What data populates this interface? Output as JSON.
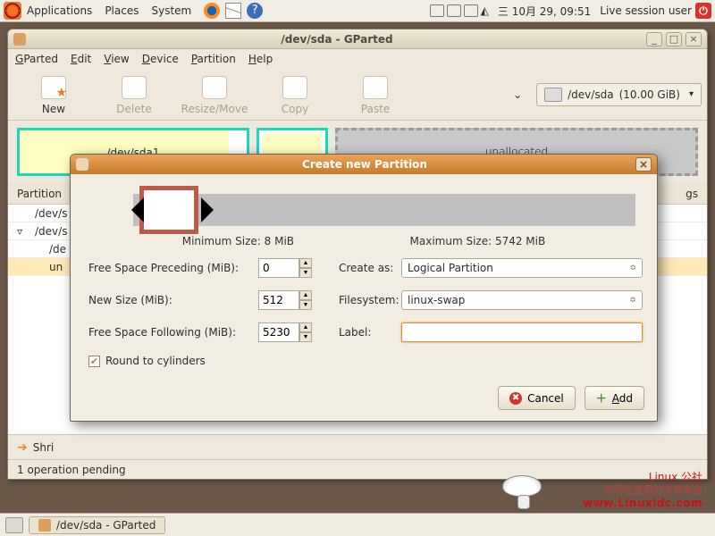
{
  "panel": {
    "menus": {
      "applications": "Applications",
      "places": "Places",
      "system": "System"
    },
    "clock": "三 10月 29, 09:51",
    "vol_icon": "◭",
    "user_label": "Live session user"
  },
  "window": {
    "title": "/dev/sda - GParted",
    "minimize": "_",
    "maximize": "□",
    "close": "×",
    "menubar": {
      "gparted": "GParted",
      "edit": "Edit",
      "view": "View",
      "device": "Device",
      "partition": "Partition",
      "help": "Help"
    },
    "toolbar": {
      "new": "New",
      "delete": "Delete",
      "resize": "Resize/Move",
      "copy": "Copy",
      "paste": "Paste"
    },
    "device": {
      "path": "/dev/sda",
      "size": "(10.00 GiB)"
    },
    "graph": {
      "p1": "/dev/sda1",
      "unalloc": "unallocated"
    },
    "table": {
      "header_partition": "Partition",
      "header_flags_suffix": "gs",
      "rows": [
        "/dev/s",
        "/dev/s",
        "/de",
        "un"
      ]
    },
    "ops": {
      "shrink": "Shri"
    },
    "statusbar": "1 operation pending"
  },
  "dialog": {
    "title": "Create new Partition",
    "close": "×",
    "min_label": "Minimum Size: 8 MiB",
    "max_label": "Maximum Size: 5742 MiB",
    "labels": {
      "free_preceding": "Free Space Preceding (MiB):",
      "new_size": "New Size (MiB):",
      "free_following": "Free Space Following (MiB):",
      "round": "Round to cylinders",
      "create_as": "Create as:",
      "filesystem": "Filesystem:",
      "label": "Label:"
    },
    "values": {
      "free_preceding": "0",
      "new_size": "512",
      "free_following": "5230",
      "create_as": "Logical Partition",
      "filesystem": "linux-swap",
      "label": ""
    },
    "buttons": {
      "cancel": "Cancel",
      "add": "Add"
    }
  },
  "taskbar": {
    "task": "/dev/sda - GParted"
  },
  "watermark": {
    "title": "Linux 公社",
    "sub": "您现在查看的文章来自",
    "url": "www.Linuxidc.com"
  }
}
